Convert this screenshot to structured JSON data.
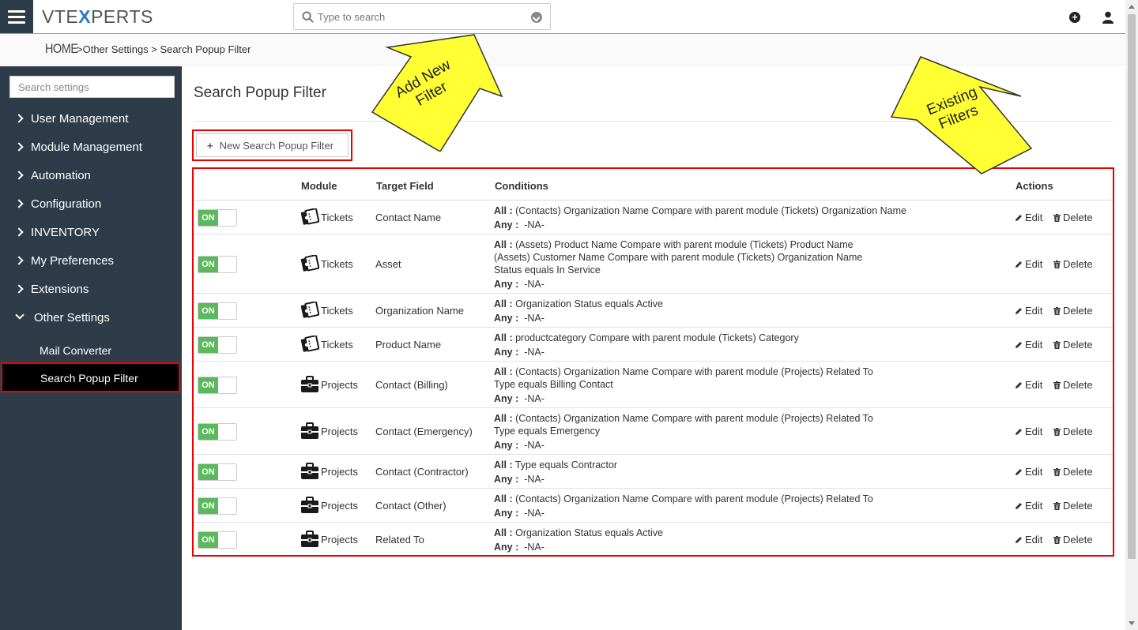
{
  "app": {
    "logo": "VTEXPERTS"
  },
  "search": {
    "placeholder": "Type to search"
  },
  "breadcrumb": {
    "home": "HOME",
    "path": ">Other Settings >  Search Popup Filter"
  },
  "sidebar": {
    "search_placeholder": "Search settings",
    "items": [
      {
        "label": "User Management"
      },
      {
        "label": "Module Management"
      },
      {
        "label": "Automation"
      },
      {
        "label": "Configuration"
      },
      {
        "label": "INVENTORY"
      },
      {
        "label": "My Preferences"
      },
      {
        "label": "Extensions"
      },
      {
        "label": "Other Settings"
      }
    ],
    "sub_items": [
      {
        "label": "Mail Converter"
      },
      {
        "label": "Search Popup Filter"
      }
    ]
  },
  "main": {
    "title": "Search Popup Filter",
    "new_button": "New Search Popup Filter",
    "columns": {
      "module": "Module",
      "target_field": "Target Field",
      "conditions": "Conditions",
      "actions": "Actions"
    },
    "toggle_label": "ON",
    "edit_label": "Edit",
    "delete_label": "Delete",
    "all_label": "All :",
    "any_label": "Any :",
    "rows": [
      {
        "module": "Tickets",
        "field": "Contact Name",
        "all": [
          "(Contacts) Organization Name Compare with parent module (Tickets) Organization Name"
        ],
        "any": "-NA-"
      },
      {
        "module": "Tickets",
        "field": "Asset",
        "all": [
          "(Assets) Product Name Compare with parent module (Tickets) Product Name",
          "(Assets) Customer Name Compare with parent module (Tickets) Organization Name",
          "Status equals In Service"
        ],
        "any": "-NA-"
      },
      {
        "module": "Tickets",
        "field": "Organization Name",
        "all": [
          "Organization Status equals Active"
        ],
        "any": "-NA-"
      },
      {
        "module": "Tickets",
        "field": "Product Name",
        "all": [
          "productcategory Compare with parent module (Tickets) Category"
        ],
        "any": "-NA-"
      },
      {
        "module": "Projects",
        "field": "Contact (Billing)",
        "all": [
          "(Contacts) Organization Name Compare with parent module (Projects) Related To",
          "Type equals Billing Contact"
        ],
        "any": "-NA-"
      },
      {
        "module": "Projects",
        "field": "Contact (Emergency)",
        "all": [
          "(Contacts) Organization Name Compare with parent module (Projects) Related To",
          "Type equals Emergency"
        ],
        "any": "-NA-"
      },
      {
        "module": "Projects",
        "field": "Contact (Contractor)",
        "all": [
          "Type equals Contractor"
        ],
        "any": "-NA-"
      },
      {
        "module": "Projects",
        "field": "Contact (Other)",
        "all": [
          "(Contacts) Organization Name Compare with parent module (Projects) Related To"
        ],
        "any": "-NA-"
      },
      {
        "module": "Projects",
        "field": "Related To",
        "all": [
          "Organization Status equals Active"
        ],
        "any": "-NA-"
      }
    ]
  },
  "annotations": {
    "add_new": [
      "Add New",
      "Filter"
    ],
    "existing": [
      "Existing",
      "Filters"
    ]
  },
  "colors": {
    "sidebar_bg": "#2e3c4a",
    "toggle_on": "#5cb85c",
    "highlight": "#ee0000",
    "callout_fill": "#ffff33",
    "accent_line": "#e8855a"
  }
}
